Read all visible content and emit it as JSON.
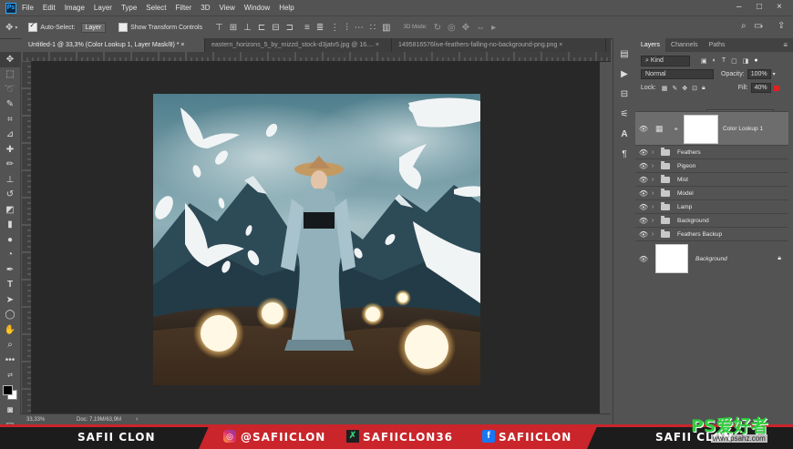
{
  "app": {
    "logo_text": "Ps"
  },
  "menu": [
    "File",
    "Edit",
    "Image",
    "Layer",
    "Type",
    "Select",
    "Filter",
    "3D",
    "View",
    "Window",
    "Help"
  ],
  "options": {
    "auto_select_label": "Auto-Select:",
    "auto_select_value": "Layer",
    "transform_label": "Show Transform Controls",
    "mode_label": "3D Mode:"
  },
  "tabs": [
    {
      "label": "Untitled-1 @ 33,3% (Color Lookup 1, Layer Mask/8) *",
      "close": "×"
    },
    {
      "label": "eastern_horizons_5_by_mizzd_stock-d3jatv5.jpg @ 16....",
      "close": "×"
    },
    {
      "label": "1495816576live-feathers-falling-no-background-png.png",
      "close": "×"
    }
  ],
  "status": {
    "zoom": "33,33%",
    "doc": "Doc: 7,19M/63,9M",
    "arrow": "›"
  },
  "panel": {
    "tabs": [
      "Layers",
      "Channels",
      "Paths"
    ],
    "filter_kind": "Kind",
    "blend_mode": "Normal",
    "opacity_label": "Opacity:",
    "opacity_value": "100%",
    "lock_label": "Lock:",
    "fill_label": "Fill:",
    "fill_value": "40%",
    "layers": [
      {
        "name": "Color Lookup 1",
        "type": "adjustment"
      },
      {
        "name": "Feathers",
        "type": "group"
      },
      {
        "name": "Pigeon",
        "type": "group"
      },
      {
        "name": "Mist",
        "type": "group"
      },
      {
        "name": "Model",
        "type": "group"
      },
      {
        "name": "Lamp",
        "type": "group"
      },
      {
        "name": "Background",
        "type": "group"
      },
      {
        "name": "Feathers Backup",
        "type": "group"
      },
      {
        "name": "Background",
        "type": "pixel",
        "locked": true
      }
    ]
  },
  "banner": {
    "left_name": "SAFII CLON",
    "instagram": "@SAFIICLON",
    "green_handle": "SAFIICLON36",
    "facebook": "SAFIICLON",
    "right_name": "SAFII CLON"
  },
  "watermark": {
    "text": "PS爱好者",
    "url": "www.psahz.com"
  },
  "colors": {
    "accent": "#31a8ff",
    "banner_red": "#c9252b",
    "workspace": "#282828"
  }
}
